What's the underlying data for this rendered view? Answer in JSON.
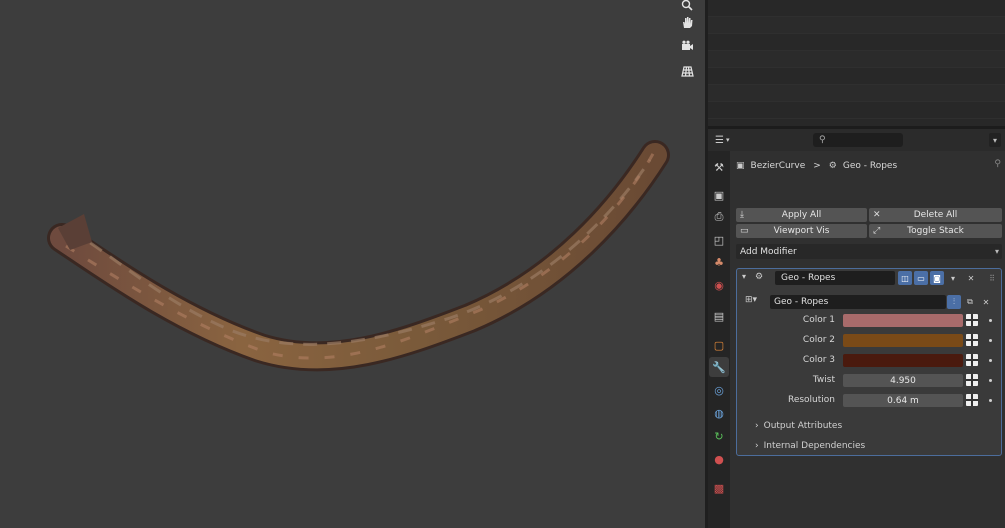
{
  "viewport": {
    "tools": [
      "zoom-icon",
      "hand-pan-icon",
      "camera-icon",
      "grid-icon"
    ]
  },
  "properties": {
    "breadcrumb": {
      "object": "BezierCurve",
      "separator": ">",
      "modifier": "Geo - Ropes"
    },
    "buttons": {
      "apply_all": "Apply All",
      "delete_all": "Delete All",
      "viewport_vis": "Viewport Vis",
      "toggle_stack": "Toggle Stack"
    },
    "add_modifier": "Add Modifier",
    "modifier": {
      "name": "Geo - Ropes",
      "node_group": "Geo - Ropes",
      "params": [
        {
          "label": "Color 1",
          "type": "color",
          "color": "#a86b6b"
        },
        {
          "label": "Color 2",
          "type": "color",
          "color": "#7a4a17"
        },
        {
          "label": "Color 3",
          "type": "color",
          "color": "#4a1a0e"
        },
        {
          "label": "Twist",
          "type": "number",
          "value": "4.950"
        },
        {
          "label": "Resolution",
          "type": "number",
          "value": "0.64 m"
        }
      ],
      "subpanels": [
        "Output Attributes",
        "Internal Dependencies"
      ]
    },
    "tab_colors": {
      "active": "#3d3d3d",
      "modifier": "#6da6e0"
    }
  }
}
